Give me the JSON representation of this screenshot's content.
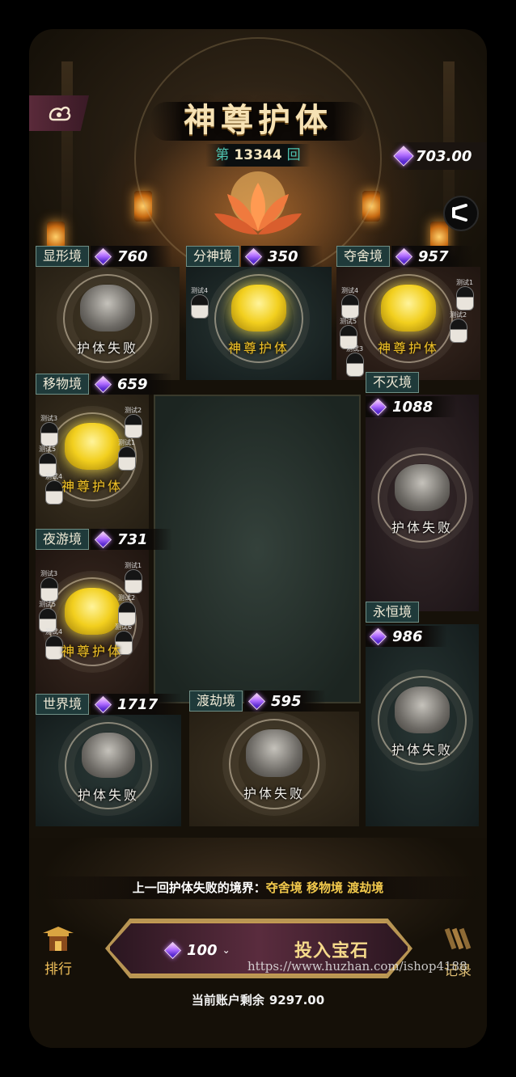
{
  "header": {
    "title": "神尊护体",
    "round_prefix": "第",
    "round_number": "13344",
    "round_suffix": "回",
    "balance": "703.00",
    "menu_icon": "cloud-swirl-icon",
    "share_icon": "share-icon"
  },
  "realms": [
    {
      "name": "显形境",
      "bet": "760",
      "status": "护体失败",
      "result": "fail"
    },
    {
      "name": "分神境",
      "bet": "350",
      "status": "神尊护体",
      "result": "win"
    },
    {
      "name": "夺舍境",
      "bet": "957",
      "status": "神尊护体",
      "result": "win"
    },
    {
      "name": "移物境",
      "bet": "659",
      "status": "神尊护体",
      "result": "win"
    },
    {
      "name": "不灭境",
      "bet": "1088",
      "status": "护体失败",
      "result": "fail"
    },
    {
      "name": "夜游境",
      "bet": "731",
      "status": "神尊护体",
      "result": "win"
    },
    {
      "name": "永恒境",
      "bet": "986",
      "status": "护体失败",
      "result": "fail"
    },
    {
      "name": "世界境",
      "bet": "1717",
      "status": "护体失败",
      "result": "fail"
    },
    {
      "name": "渡劫境",
      "bet": "595",
      "status": "护体失败",
      "result": "fail"
    }
  ],
  "players": {
    "fenshen": [
      "测试4"
    ],
    "duoshe": [
      "测试4",
      "测试1",
      "测试5",
      "测试2",
      "测试3"
    ],
    "yiwu": [
      "测试3",
      "测试2",
      "测试5",
      "测试1",
      "测试4"
    ],
    "yeyou": [
      "测试3",
      "测试1",
      "测试5",
      "测试2",
      "测试4",
      "测试6"
    ]
  },
  "footer": {
    "last_fail_label": "上一回护体失败的境界：",
    "last_fail_realms": "夺舍境 移物境 渡劫境",
    "rank_label": "排行",
    "record_label": "记录",
    "bet_amount": "100",
    "invest_label": "投入宝石",
    "account_label": "当前账户剩余",
    "account_value": "9297.00",
    "watermark": "https://www.huzhan.com/ishop4188"
  },
  "colors": {
    "accent_gold": "#e6b63a",
    "tag_teal": "#1f3a3a",
    "win_yellow": "#f0c228"
  }
}
